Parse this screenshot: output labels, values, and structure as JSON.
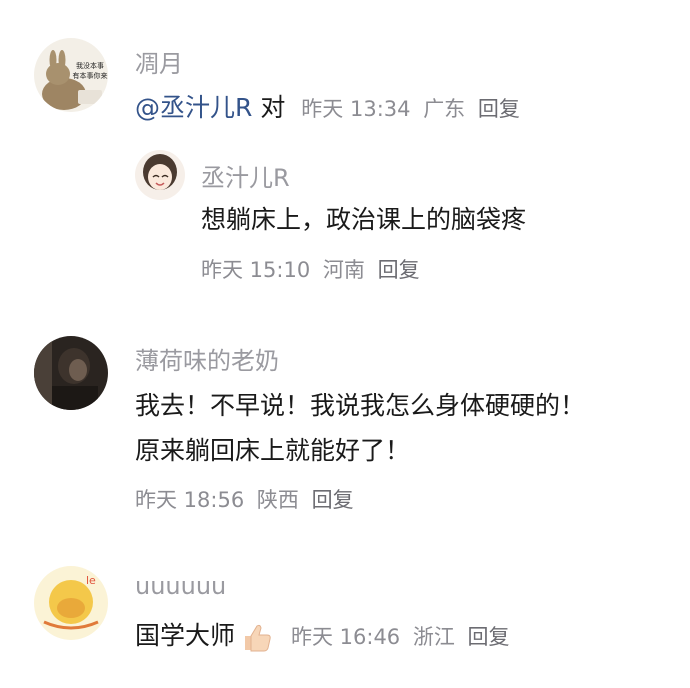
{
  "comments": [
    {
      "username": "凋月",
      "mention": "@丞汁儿R",
      "text": "对",
      "time": "昨天 13:34",
      "location": "广东",
      "reply_label": "回复",
      "avatar_text_line1": "我没本事",
      "avatar_text_line2": "有本事你来"
    },
    {
      "username": "丞汁儿R",
      "text": "想躺床上，政治课上的脑袋疼",
      "time": "昨天 15:10",
      "location": "河南",
      "reply_label": "回复"
    },
    {
      "username": "薄荷味的老奶",
      "text_line1": "我去！不早说！我说我怎么身体硬硬的！",
      "text_line2": "原来躺回床上就能好了！",
      "time": "昨天 18:56",
      "location": "陕西",
      "reply_label": "回复"
    },
    {
      "username": "uuuuuu",
      "text": "国学大师",
      "emoji": "thumbs-up",
      "time": "昨天 16:46",
      "location": "浙江",
      "reply_label": "回复",
      "avatar_text": "le"
    }
  ]
}
